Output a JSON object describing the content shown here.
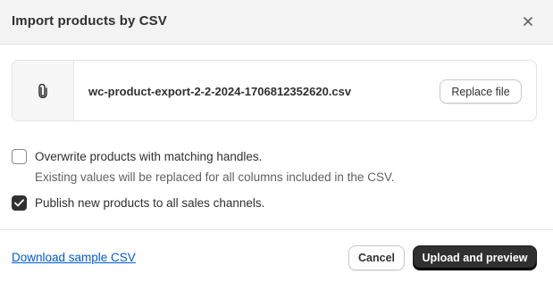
{
  "dialog": {
    "title": "Import products by CSV",
    "close_icon": "close-icon"
  },
  "file": {
    "icon": "paperclip-icon",
    "name": "wc-product-export-2-2-2024-1706812352620.csv",
    "replace_label": "Replace file"
  },
  "options": [
    {
      "label": "Overwrite products with matching handles.",
      "checked": false,
      "help": "Existing values will be replaced for all columns included in the CSV."
    },
    {
      "label": "Publish new products to all sales channels.",
      "checked": true
    }
  ],
  "footer": {
    "download_link": "Download sample CSV",
    "cancel_label": "Cancel",
    "primary_label": "Upload and preview"
  },
  "colors": {
    "primary_button": "#303030",
    "link": "#005bd3",
    "header_bg": "#f3f3f3"
  }
}
